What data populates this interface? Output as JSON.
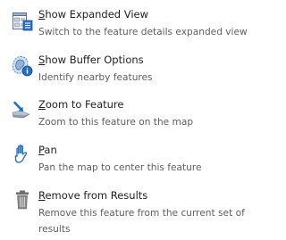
{
  "menu": {
    "items": [
      {
        "icon": "expanded-view-icon",
        "title_accel": "S",
        "title_rest": "how Expanded View",
        "description": "Switch to the feature details expanded view"
      },
      {
        "icon": "buffer-options-icon",
        "title_accel": "S",
        "title_rest": "how Buffer Options",
        "description": "Identify nearby features"
      },
      {
        "icon": "zoom-to-feature-icon",
        "title_accel": "Z",
        "title_rest": "oom to Feature",
        "description": "Zoom to this feature on the map"
      },
      {
        "icon": "pan-hand-icon",
        "title_accel": "P",
        "title_rest": "an",
        "description": "Pan the map to center this feature"
      },
      {
        "icon": "trash-can-icon",
        "title_accel": "R",
        "title_rest": "emove from Results",
        "description": "Remove this feature from the current set of results"
      }
    ]
  }
}
